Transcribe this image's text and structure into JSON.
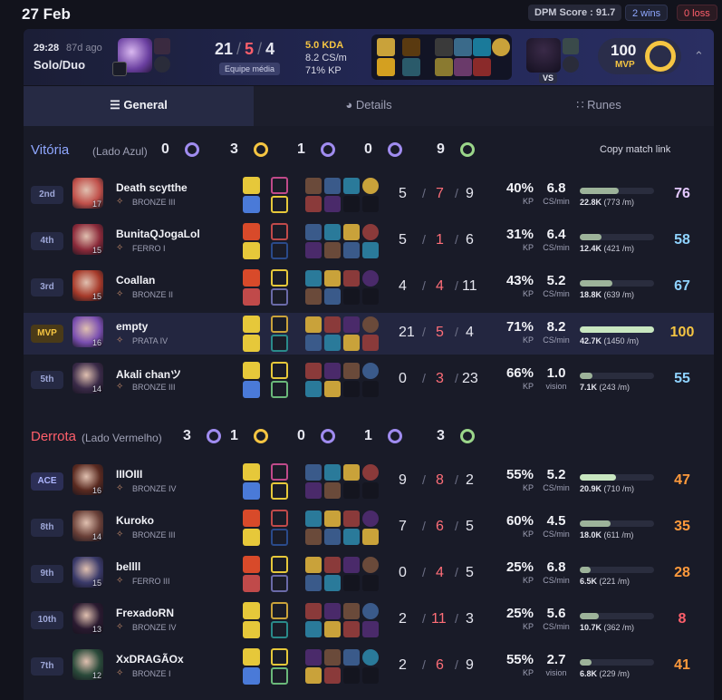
{
  "header": {
    "date": "27 Feb",
    "dpm_score": "DPM Score : 91.7",
    "wins": "2 wins",
    "losses": "0 loss"
  },
  "summary": {
    "time": "29:28",
    "ago": "87d ago",
    "queue": "Solo/Duo",
    "kills": "21",
    "deaths": "5",
    "assists": "4",
    "team_avg": "Equipe média",
    "kda": "5.0 KDA",
    "cs": "8.2 CS/m",
    "kp": "71% KP",
    "vs": "VS",
    "score": "100",
    "score_label": "MVP"
  },
  "tabs": [
    {
      "label": "General",
      "icon": "list-icon"
    },
    {
      "label": "Details",
      "icon": "pie-icon"
    },
    {
      "label": "Runes",
      "icon": "grid-icon"
    }
  ],
  "copy_link": "Copy match link",
  "teams": [
    {
      "result": "Vitória",
      "side": "(Lado Azul)",
      "color": "#8fa7ff",
      "objectives": [
        {
          "n": "0",
          "icon": "baron-icon"
        },
        {
          "n": "3",
          "icon": "dragon-icon"
        },
        {
          "n": "1",
          "icon": "herald-icon"
        },
        {
          "n": "0",
          "icon": "grubs-icon"
        },
        {
          "n": "9",
          "icon": "tower-icon"
        }
      ],
      "players": [
        {
          "rank_label": "2nd",
          "name": "Death scytthe",
          "tier": "BRONZE III",
          "level": "17",
          "k": "5",
          "d": "7",
          "a": "9",
          "kp": "40%",
          "cs": "6.8",
          "cs_label": "CS/min",
          "dmg": "22.8K",
          "dpm": "(773 /m)",
          "dmg_frac": 0.53,
          "score": "76",
          "score_color": "#e3c8ff",
          "av": "#c0504a"
        },
        {
          "rank_label": "4th",
          "name": "BunitaQJogaLol",
          "tier": "FERRO I",
          "level": "15",
          "k": "5",
          "d": "1",
          "a": "6",
          "kp": "31%",
          "cs": "6.4",
          "cs_label": "CS/min",
          "dmg": "12.4K",
          "dpm": "(421 /m)",
          "dmg_frac": 0.29,
          "score": "58",
          "score_color": "#8fd3ff",
          "av": "#8b2a3a"
        },
        {
          "rank_label": "3rd",
          "name": "Coallan",
          "tier": "BRONZE II",
          "level": "15",
          "k": "4",
          "d": "4",
          "a": "11",
          "kp": "43%",
          "cs": "5.2",
          "cs_label": "CS/min",
          "dmg": "18.8K",
          "dpm": "(639 /m)",
          "dmg_frac": 0.44,
          "score": "67",
          "score_color": "#8fd3ff",
          "av": "#a63a2a"
        },
        {
          "rank_label": "MVP",
          "name": "empty",
          "tier": "PRATA IV",
          "level": "16",
          "k": "21",
          "d": "5",
          "a": "4",
          "kp": "71%",
          "cs": "8.2",
          "cs_label": "CS/min",
          "dmg": "42.7K",
          "dpm": "(1450 /m)",
          "dmg_frac": 1.0,
          "score": "100",
          "score_color": "#f5c542",
          "av": "#7a4fb0"
        },
        {
          "rank_label": "5th",
          "name": "Akali chanツ",
          "tier": "BRONZE III",
          "level": "14",
          "k": "0",
          "d": "3",
          "a": "23",
          "kp": "66%",
          "cs": "1.0",
          "cs_label": "vision",
          "dmg": "7.1K",
          "dpm": "(243 /m)",
          "dmg_frac": 0.17,
          "score": "55",
          "score_color": "#8fd3ff",
          "av": "#3a2a48"
        }
      ]
    },
    {
      "result": "Derrota",
      "side": "(Lado Vermelho)",
      "color": "#ff5f6b",
      "objectives": [
        {
          "n": "3",
          "icon": "baron-icon"
        },
        {
          "n": "1",
          "icon": "dragon-icon"
        },
        {
          "n": "0",
          "icon": "herald-icon"
        },
        {
          "n": "1",
          "icon": "grubs-icon"
        },
        {
          "n": "3",
          "icon": "tower-icon"
        }
      ],
      "players": [
        {
          "rank_label": "ACE",
          "name": "IIIOIII",
          "tier": "BRONZE IV",
          "level": "16",
          "k": "9",
          "d": "8",
          "a": "2",
          "kp": "55%",
          "cs": "5.2",
          "cs_label": "CS/min",
          "dmg": "20.9K",
          "dpm": "(710 /m)",
          "dmg_frac": 0.49,
          "score": "47",
          "score_color": "#ff9a3c",
          "av": "#5a2a20"
        },
        {
          "rank_label": "8th",
          "name": "Kuroko",
          "tier": "BRONZE III",
          "level": "14",
          "k": "7",
          "d": "6",
          "a": "5",
          "kp": "60%",
          "cs": "4.5",
          "cs_label": "CS/min",
          "dmg": "18.0K",
          "dpm": "(611 /m)",
          "dmg_frac": 0.42,
          "score": "35",
          "score_color": "#ff9a3c",
          "av": "#6a4038"
        },
        {
          "rank_label": "9th",
          "name": "bellll",
          "tier": "FERRO III",
          "level": "15",
          "k": "0",
          "d": "4",
          "a": "5",
          "kp": "25%",
          "cs": "6.8",
          "cs_label": "CS/min",
          "dmg": "6.5K",
          "dpm": "(221 /m)",
          "dmg_frac": 0.15,
          "score": "28",
          "score_color": "#ff9a3c",
          "av": "#3a3a6a"
        },
        {
          "rank_label": "10th",
          "name": "FrexadoRN",
          "tier": "BRONZE IV",
          "level": "13",
          "k": "2",
          "d": "11",
          "a": "3",
          "kp": "25%",
          "cs": "5.6",
          "cs_label": "CS/min",
          "dmg": "10.7K",
          "dpm": "(362 /m)",
          "dmg_frac": 0.25,
          "score": "8",
          "score_color": "#ff5f6b",
          "av": "#2a1a30"
        },
        {
          "rank_label": "7th",
          "name": "XxDRAGÃOx",
          "tier": "BRONZE I",
          "level": "12",
          "k": "2",
          "d": "6",
          "a": "9",
          "kp": "55%",
          "cs": "2.7",
          "cs_label": "vision",
          "dmg": "6.8K",
          "dpm": "(229 /m)",
          "dmg_frac": 0.16,
          "score": "41",
          "score_color": "#ff9a3c",
          "av": "#2a4a3a"
        }
      ]
    }
  ]
}
